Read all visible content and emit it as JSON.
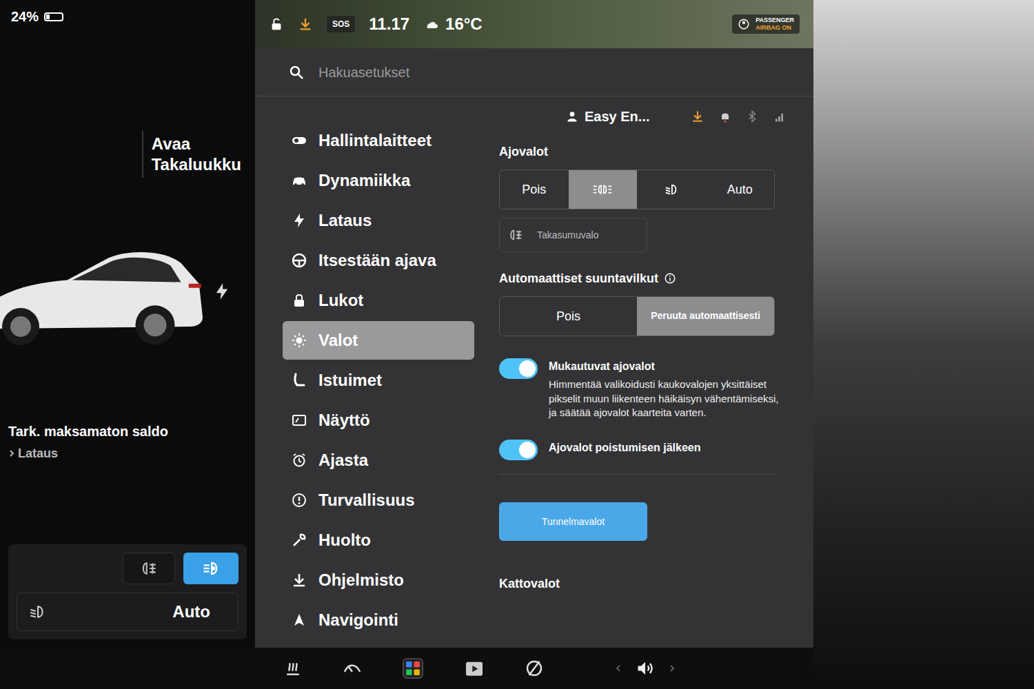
{
  "status_bar": {
    "battery": {
      "reading": "24%",
      "level": 0.24
    },
    "sos": "SOS",
    "time": "11.17",
    "temperature": "16°C",
    "airbag": [
      "PASSENGER",
      "AIRBAG ON"
    ]
  },
  "search": {
    "placeholder": "Hakuasetukset"
  },
  "profile": {
    "name": "Easy En..."
  },
  "left_panel": {
    "trunk_button": [
      "Avaa",
      "Takaluukku"
    ],
    "notice": {
      "title": "Tark. maksamaton saldo",
      "link": "Lataus"
    },
    "quick_lights": {
      "fog_on": false,
      "auto_on": true,
      "label": "Auto"
    }
  },
  "sidebar": {
    "items": [
      {
        "label": "Hallintalaitteet",
        "selected": false
      },
      {
        "label": "Dynamiikka",
        "selected": false
      },
      {
        "label": "Lataus",
        "selected": false
      },
      {
        "label": "Itsestään ajava",
        "selected": false
      },
      {
        "label": "Lukot",
        "selected": false
      },
      {
        "label": "Valot",
        "selected": true
      },
      {
        "label": "Istuimet",
        "selected": false
      },
      {
        "label": "Näyttö",
        "selected": false
      },
      {
        "label": "Ajasta",
        "selected": false
      },
      {
        "label": "Turvallisuus",
        "selected": false
      },
      {
        "label": "Huolto",
        "selected": false
      },
      {
        "label": "Ohjelmisto",
        "selected": false
      },
      {
        "label": "Navigointi",
        "selected": false
      }
    ]
  },
  "headlights": {
    "title": "Ajovalot",
    "options": [
      {
        "kind": "text",
        "label": "Pois",
        "selected": false
      },
      {
        "kind": "parking",
        "selected": true
      },
      {
        "kind": "lowbeam",
        "selected": false
      },
      {
        "kind": "text",
        "label": "Auto",
        "selected": false
      }
    ]
  },
  "rear_fog": {
    "label": "Takasumuvalo",
    "on": false
  },
  "turn_signals": {
    "title": "Automaattiset suuntavilkut",
    "options": [
      {
        "label": "Pois",
        "selected": false
      },
      {
        "label": "Peruuta automaattisesti",
        "selected": true
      }
    ]
  },
  "toggles": [
    {
      "label": "Mukautuvat ajovalot",
      "description": "Himmentää valikoidusti kaukovalojen yksittäiset pikselit muun liikenteen häikäisyn vähentämiseksi, ja säätää ajovalot kaarteita varten.",
      "on": true
    },
    {
      "label": "Ajovalot poistumisen jälkeen",
      "on": true
    }
  ],
  "ambient_button": "Tunnelmavalot",
  "next_section": "Kattovalot"
}
